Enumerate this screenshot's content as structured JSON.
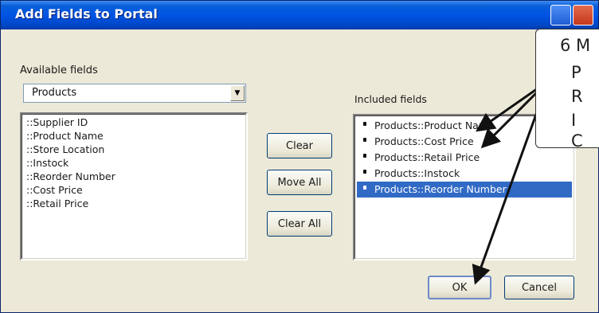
{
  "window": {
    "title": "Add Fields to Portal"
  },
  "available": {
    "label": "Available fields",
    "table_selected": "Products",
    "items": [
      "::Supplier ID",
      "::Product Name",
      "::Store Location",
      "::Instock",
      "::Reorder Number",
      "::Cost Price",
      "::Retail Price"
    ]
  },
  "buttons": {
    "clear": "Clear",
    "move_all": "Move All",
    "clear_all": "Clear All",
    "ok": "OK",
    "cancel": "Cancel"
  },
  "included": {
    "label": "Included fields",
    "items": [
      "Products::Product Name",
      "Products::Cost Price",
      "Products::Retail Price",
      "Products::Instock",
      "Products::Reorder Number"
    ],
    "selected_index": 4
  },
  "callout": {
    "lines": [
      "6 M",
      "P",
      "R",
      "I",
      "C"
    ]
  },
  "colors": {
    "selection": "#316ac5",
    "titlebar": "#0054e3",
    "dialog_bg": "#ece9d8"
  }
}
